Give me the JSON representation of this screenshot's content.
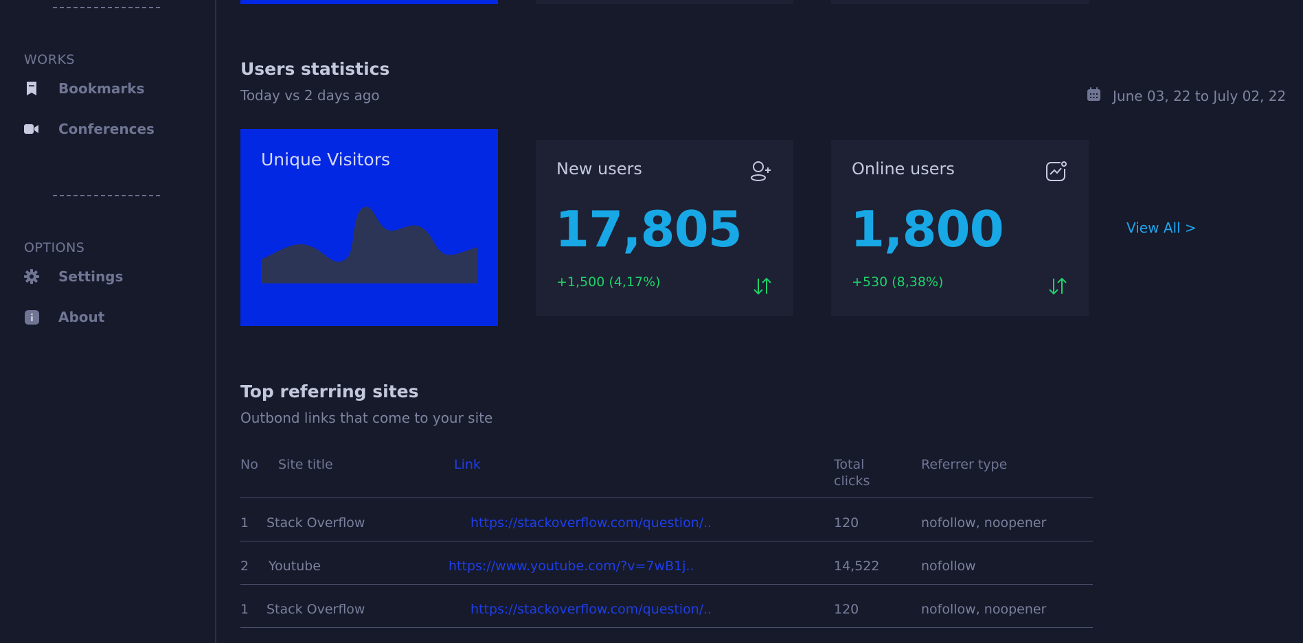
{
  "sidebar": {
    "works_label": "WORKS",
    "options_label": "OPTIONS",
    "works_items": [
      {
        "label": "Bookmarks",
        "icon": "bookmark-icon"
      },
      {
        "label": "Conferences",
        "icon": "video-camera-icon"
      }
    ],
    "options_items": [
      {
        "label": "Settings",
        "icon": "gear-icon"
      },
      {
        "label": "About",
        "icon": "info-icon"
      }
    ]
  },
  "users_statistics": {
    "title": "Users statistics",
    "subtitle": "Today vs 2 days ago",
    "date_range": "June 03, 22 to July 02, 22",
    "unique_visitors": {
      "title": "Unique Visitors"
    },
    "new_users": {
      "title": "New users",
      "value": "17,805",
      "delta": "+1,500 (4,17%)",
      "icon": "user-add-icon"
    },
    "online_users": {
      "title": "Online users",
      "value": "1,800",
      "delta": "+530 (8,38%)",
      "icon": "trend-chart-icon"
    },
    "view_all": "View All >"
  },
  "referring": {
    "title": "Top referring sites",
    "subtitle": "Outbond links that come to your site",
    "headers": {
      "no": "No",
      "site_title": "Site title",
      "link": "Link",
      "total_clicks_1": "Total",
      "total_clicks_2": "clicks",
      "referrer_type": "Referrer type"
    },
    "rows": [
      {
        "no": "1",
        "site": "Stack Overflow",
        "link": "https://stackoverflow.com/question/..",
        "clicks": "120",
        "type": "nofollow, noopener"
      },
      {
        "no": "2",
        "site": "Youtube",
        "link": "https://www.youtube.com/?v=7wB1j..",
        "clicks": "14,522",
        "type": "nofollow"
      },
      {
        "no": "1",
        "site": "Stack Overflow",
        "link": "https://stackoverflow.com/question/..",
        "clicks": "120",
        "type": "nofollow, noopener"
      }
    ]
  },
  "colors": {
    "background": "#161a2b",
    "card": "#1d2133",
    "accent_blue": "#0328e4",
    "value_cyan": "#18a8e6",
    "positive_green": "#1fd26a",
    "link_blue": "#1f3ee8"
  }
}
